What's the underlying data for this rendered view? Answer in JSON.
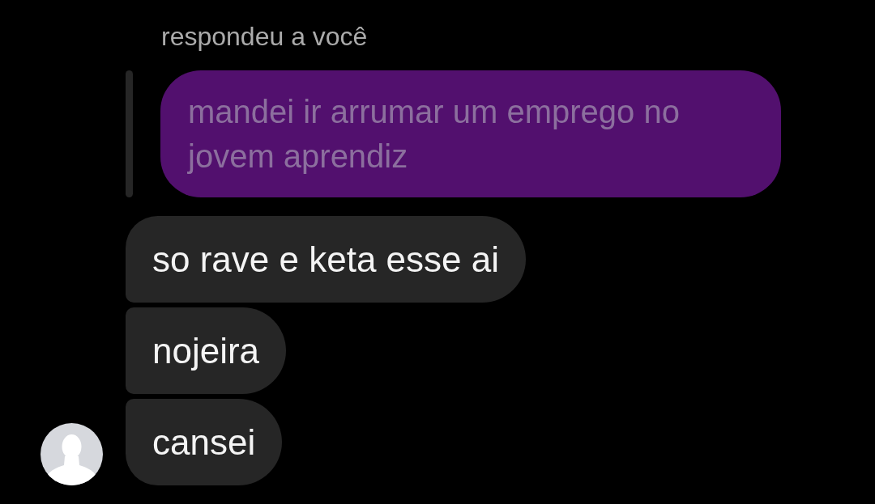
{
  "reply_label": "respondeu a você",
  "quoted_message": {
    "text": "mandei ir arrumar um emprego no jovem aprendiz"
  },
  "messages": [
    {
      "text": "so rave e keta esse ai"
    },
    {
      "text": "nojeira"
    },
    {
      "text": "cansei"
    }
  ]
}
